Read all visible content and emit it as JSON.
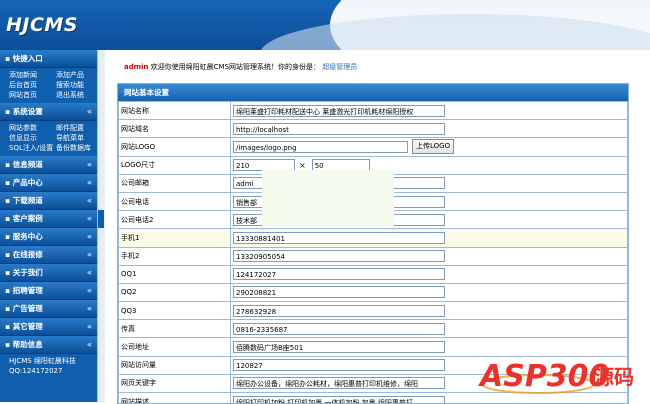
{
  "app": {
    "logo_text": "HJCMS"
  },
  "sidebar": {
    "quick_entry": {
      "title": "快捷入口",
      "links": [
        "添加新闻",
        "添加产品",
        "后台首页",
        "搜索功能",
        "网站首页",
        "退出系统"
      ]
    },
    "system_settings": {
      "title": "系统设置",
      "links": [
        "网站参数",
        "邮件配置",
        "信息显示",
        "导航菜单",
        "SQL注入/设置",
        "备份数据库"
      ]
    },
    "groups": [
      "信息频道",
      "产品中心",
      "下载频道",
      "客户案例",
      "服务中心",
      "在线报修",
      "关于我们",
      "招聘管理",
      "广告管理",
      "其它管理"
    ],
    "help": {
      "title": "帮助信息",
      "lines": [
        "HJCMS 绵阳虹晨科技",
        "QQ:124172027"
      ]
    }
  },
  "welcome": {
    "user": "admin",
    "message": "欢迎你使用绵阳虹晨CMS网站管理系统！你的身份是：",
    "role": "超级管理员"
  },
  "panel": {
    "title": "网站基本设置",
    "upload_button": "上传LOGO",
    "times_symbol": "×",
    "fields": [
      {
        "label": "网站名称",
        "value": "绵阳莱盛打印耗材配送中心  莱盛激光打印机耗材绵阳授权"
      },
      {
        "label": "网站域名",
        "value": "http://localhost"
      },
      {
        "label": "网站LOGO",
        "value": "/images/logo.png"
      },
      {
        "label": "LOGO尺寸",
        "width": "210",
        "height": "50"
      },
      {
        "label": "公司邮箱",
        "value": "admi"
      },
      {
        "label": "公司电话",
        "value": "销售部"
      },
      {
        "label": "公司电话2",
        "value": "技术部"
      },
      {
        "label": "手机1",
        "value": "13330881401"
      },
      {
        "label": "手机2",
        "value": "13320905054"
      },
      {
        "label": "QQ1",
        "value": "124172027"
      },
      {
        "label": "QQ2",
        "value": "290208821"
      },
      {
        "label": "QQ3",
        "value": "278632928"
      },
      {
        "label": "传真",
        "value": "0816-2335687"
      },
      {
        "label": "公司地址",
        "value": "佰腾数码广场B座501"
      },
      {
        "label": "网站访问量",
        "value": "120827"
      },
      {
        "label": "网页关键字",
        "value": "绵阳办公设备，绵阳办公耗材，绵阳惠普打印机维修，绵阳"
      },
      {
        "label": "网站描述",
        "value": "绵阳打印机加粉,打印机加墨,一体机加粉 加墨,绵阳惠普打"
      }
    ]
  },
  "watermark": {
    "text": "ASP300",
    "suffix": "源码"
  }
}
